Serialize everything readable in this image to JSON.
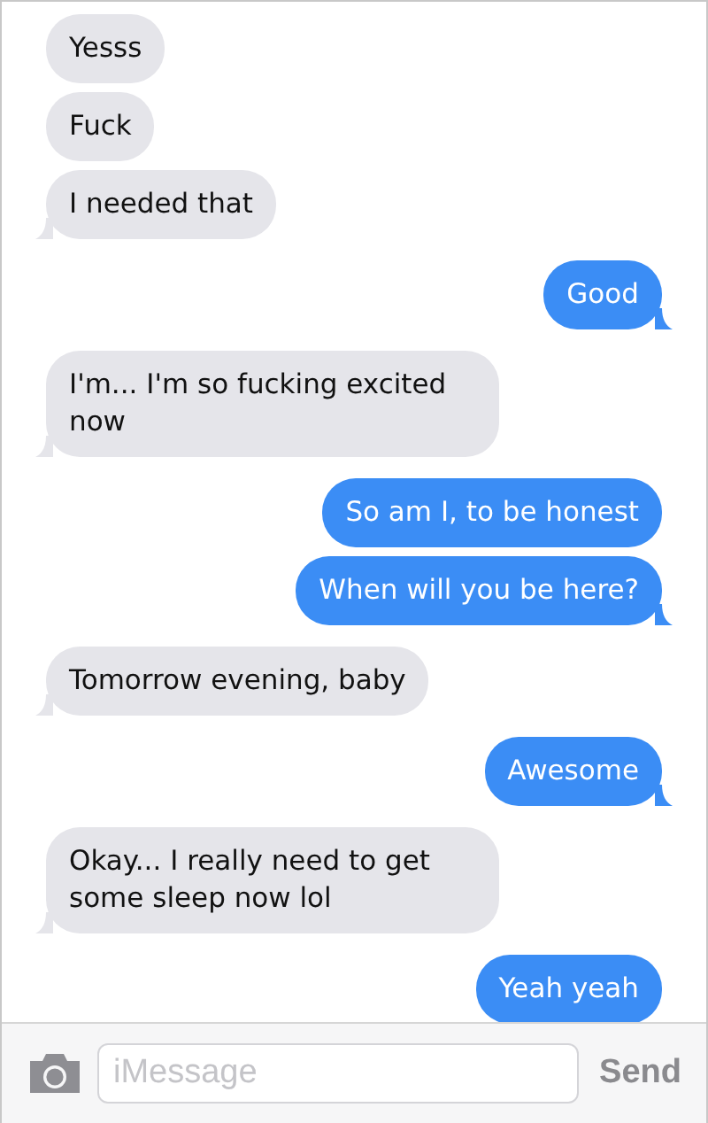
{
  "messages": [
    {
      "outgoing": false,
      "text": "Yesss",
      "tail": false
    },
    {
      "outgoing": false,
      "text": "Fuck",
      "tail": false
    },
    {
      "outgoing": false,
      "text": "I needed that",
      "tail": true
    },
    {
      "outgoing": true,
      "text": "Good",
      "tail": true
    },
    {
      "outgoing": false,
      "text": "I'm... I'm so fucking excited now",
      "tail": true
    },
    {
      "outgoing": true,
      "text": "So am I, to be honest",
      "tail": false
    },
    {
      "outgoing": true,
      "text": "When will you be here?",
      "tail": true
    },
    {
      "outgoing": false,
      "text": "Tomorrow evening, baby",
      "tail": true
    },
    {
      "outgoing": true,
      "text": "Awesome",
      "tail": true
    },
    {
      "outgoing": false,
      "text": "Okay... I really need to get some sleep now lol",
      "tail": true
    },
    {
      "outgoing": true,
      "text": "Yeah yeah",
      "tail": false
    }
  ],
  "composer": {
    "placeholder": "iMessage",
    "send": "Send"
  }
}
